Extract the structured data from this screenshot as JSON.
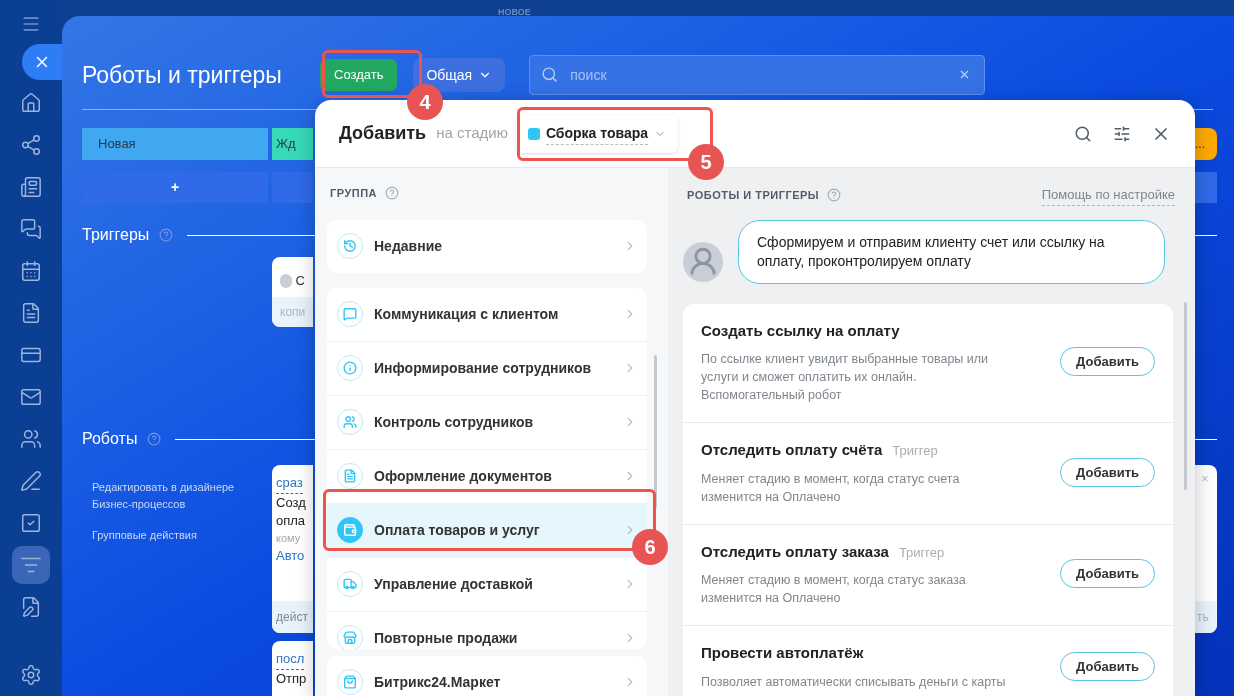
{
  "top_label": "НОВОЕ",
  "rail_items": [
    {
      "kind": "close",
      "selected": false
    },
    {
      "kind": "home",
      "selected": false
    },
    {
      "kind": "nodes",
      "selected": false
    },
    {
      "kind": "news",
      "selected": false
    },
    {
      "kind": "chat",
      "selected": false
    },
    {
      "kind": "calendar",
      "selected": false
    },
    {
      "kind": "document",
      "selected": false
    },
    {
      "kind": "card",
      "selected": false
    },
    {
      "kind": "mail",
      "selected": false
    },
    {
      "kind": "people",
      "selected": false
    },
    {
      "kind": "pen",
      "selected": false
    },
    {
      "kind": "task",
      "selected": false
    },
    {
      "kind": "funnel",
      "selected": true
    },
    {
      "kind": "file-edit",
      "selected": false
    },
    {
      "kind": "settings",
      "selected": false
    }
  ],
  "page_title": "Роботы и триггеры",
  "create_button": "Создать",
  "view_dropdown": "Общая",
  "search": {
    "placeholder": "поиск"
  },
  "stages": [
    {
      "label": "Новая",
      "color": "#3fa8f0"
    },
    {
      "label": "Жд",
      "color": "#37d9b9"
    }
  ],
  "right_stage": {
    "label": "...",
    "color": "#ffa900"
  },
  "add_button": "+",
  "triggers": {
    "title": "Триггеры",
    "card_text": "С",
    "card_footer": "копи"
  },
  "robots": {
    "title": "Роботы",
    "links": [
      "Редактировать в дизайнере Бизнес-процессов",
      "Групповые действия"
    ]
  },
  "robot_cards": [
    {
      "timing": "сраз",
      "lines": [
        "Созд",
        "опла"
      ],
      "meta": "кому",
      "link": "Авто",
      "footer": "дейст"
    },
    {
      "timing": "посл",
      "lines": [
        "Отпр"
      ]
    }
  ],
  "right_card": {
    "close": "×",
    "footer": "ть"
  },
  "popup": {
    "title": "Добавить",
    "stage_prefix": "на стадию",
    "stage": {
      "label": "Сборка товара",
      "color": "#2fc6f6"
    },
    "group_heading": "ГРУППА",
    "recent": {
      "label": "Недавние",
      "kind": "recent"
    },
    "groups": [
      {
        "label": "Коммуникация с клиентом",
        "kind": "chat",
        "selected": false
      },
      {
        "label": "Информирование сотрудников",
        "kind": "info",
        "selected": false
      },
      {
        "label": "Контроль сотрудников",
        "kind": "people",
        "selected": false
      },
      {
        "label": "Оформление документов",
        "kind": "document",
        "selected": false
      },
      {
        "label": "Оплата товаров и услуг",
        "kind": "wallet",
        "selected": true
      },
      {
        "label": "Управление доставкой",
        "kind": "truck",
        "selected": false
      },
      {
        "label": "Повторные продажи",
        "kind": "register",
        "selected": false
      }
    ],
    "market": {
      "label": "Битрикс24.Маркет",
      "kind": "market"
    },
    "robots_heading": "РОБОТЫ И ТРИГГЕРЫ",
    "help_link": "Помощь по настройке",
    "bubble": "Сформируем и отправим клиенту счет или ссылку на оплату, проконтролируем оплату",
    "items": [
      {
        "title": "Создать ссылку на оплату",
        "description": "По ссылке клиент увидит выбранные товары или услуги и сможет оплатить их онлайн. Вспомогательный робот",
        "button": "Добавить"
      },
      {
        "title": "Отследить оплату счёта",
        "tag": "Триггер",
        "description": "Меняет стадию в момент, когда статус счета изменится на Оплачено",
        "button": "Добавить"
      },
      {
        "title": "Отследить оплату заказа",
        "tag": "Триггер",
        "description": "Меняет стадию в момент, когда статус заказа изменится на Оплачено",
        "button": "Добавить"
      },
      {
        "title": "Провести автоплатёж",
        "description": "Позволяет автоматически списывать деньги с карты",
        "button": "Добавить"
      }
    ]
  },
  "annotations": [
    {
      "number": "4"
    },
    {
      "number": "5"
    },
    {
      "number": "6"
    }
  ]
}
